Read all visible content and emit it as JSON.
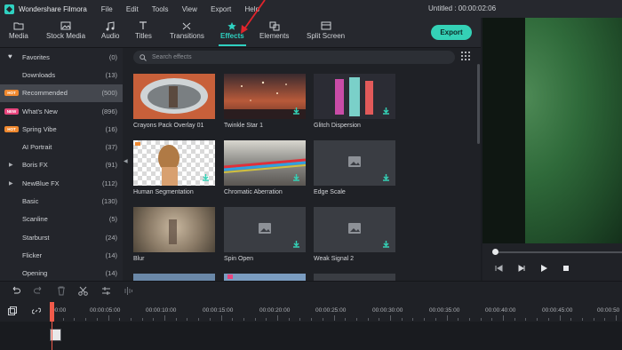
{
  "app": {
    "name": "Wondershare Filmora",
    "title": "Untitled : 00:00:02:06",
    "menu": [
      "File",
      "Edit",
      "Tools",
      "View",
      "Export",
      "Help"
    ]
  },
  "toolbar": {
    "tabs": [
      {
        "label": "Media",
        "icon": "folder-icon"
      },
      {
        "label": "Stock Media",
        "icon": "stock-media-icon"
      },
      {
        "label": "Audio",
        "icon": "music-note-icon"
      },
      {
        "label": "Titles",
        "icon": "text-icon"
      },
      {
        "label": "Transitions",
        "icon": "transition-icon"
      },
      {
        "label": "Effects",
        "icon": "effects-icon"
      },
      {
        "label": "Elements",
        "icon": "elements-icon"
      },
      {
        "label": "Split Screen",
        "icon": "split-screen-icon"
      }
    ],
    "active_tab": "Effects",
    "export_label": "Export"
  },
  "sidebar": {
    "items": [
      {
        "label": "Favorites",
        "count": "(0)",
        "icon": "heart-icon"
      },
      {
        "label": "Downloads",
        "count": "(13)"
      },
      {
        "label": "Recommended",
        "count": "(500)",
        "badge": "HOT",
        "selected": true
      },
      {
        "label": "What's New",
        "count": "(896)",
        "badge": "NEW"
      },
      {
        "label": "Spring Vibe",
        "count": "(16)",
        "badge": "HOT"
      },
      {
        "label": "AI Portrait",
        "count": "(37)"
      },
      {
        "label": "Boris FX",
        "count": "(91)",
        "expandable": true
      },
      {
        "label": "NewBlue FX",
        "count": "(112)",
        "expandable": true
      },
      {
        "label": "Basic",
        "count": "(130)"
      },
      {
        "label": "Scanline",
        "count": "(5)"
      },
      {
        "label": "Starburst",
        "count": "(24)"
      },
      {
        "label": "Flicker",
        "count": "(14)"
      },
      {
        "label": "Opening",
        "count": "(14)"
      }
    ]
  },
  "effects": {
    "search_placeholder": "Search effects",
    "cards": [
      {
        "name": "Crayons Pack Overlay 01"
      },
      {
        "name": "Twinkle Star 1"
      },
      {
        "name": "Glitch Dispersion"
      },
      {
        "name": "Human Segmentation"
      },
      {
        "name": "Chromatic Aberration"
      },
      {
        "name": "Edge Scale"
      },
      {
        "name": "Blur"
      },
      {
        "name": "Spin Open"
      },
      {
        "name": "Weak Signal 2"
      }
    ]
  },
  "timeline": {
    "ruler_labels": [
      "00:00",
      "00:00:05:00",
      "00:00:10:00",
      "00:00:15:00",
      "00:00:20:00",
      "00:00:25:00",
      "00:00:30:00",
      "00:00:35:00",
      "00:00:40:00",
      "00:00:45:00",
      "00:00:50"
    ]
  },
  "colors": {
    "accent": "#2fd1c1",
    "export": "#34d1b6",
    "hot_badge": "#f0892f",
    "new_badge": "#e7457d",
    "playhead": "#f05a4a",
    "annotation_arrow": "#e0242b"
  }
}
